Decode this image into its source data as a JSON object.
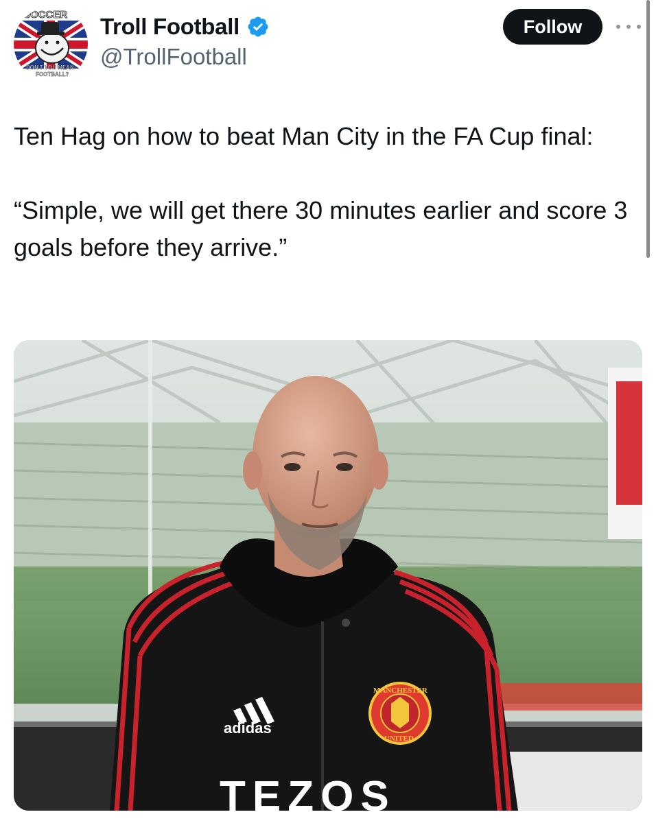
{
  "profile": {
    "display_name": "Troll Football",
    "handle": "@TrollFootball",
    "avatar_top_text": "SOCCER",
    "avatar_bottom_text_1": "DON'T YOU MEAN",
    "avatar_bottom_text_2": "FOOTBALL?"
  },
  "actions": {
    "follow_label": "Follow"
  },
  "tweet": {
    "line1": "Ten Hag on how to beat Man City in the FA Cup final:",
    "line2": "“Simple, we will get there 30 minutes earlier and score 3 goals before they arrive.”"
  },
  "media": {
    "sponsor_brand": "adidas",
    "shirt_sponsor": "TEZOS",
    "crest_top": "MANCHESTER",
    "crest_bottom": "UNITED"
  },
  "colors": {
    "verified": "#1d9bf0",
    "follow_bg": "#0f1419",
    "handle": "#536471"
  }
}
